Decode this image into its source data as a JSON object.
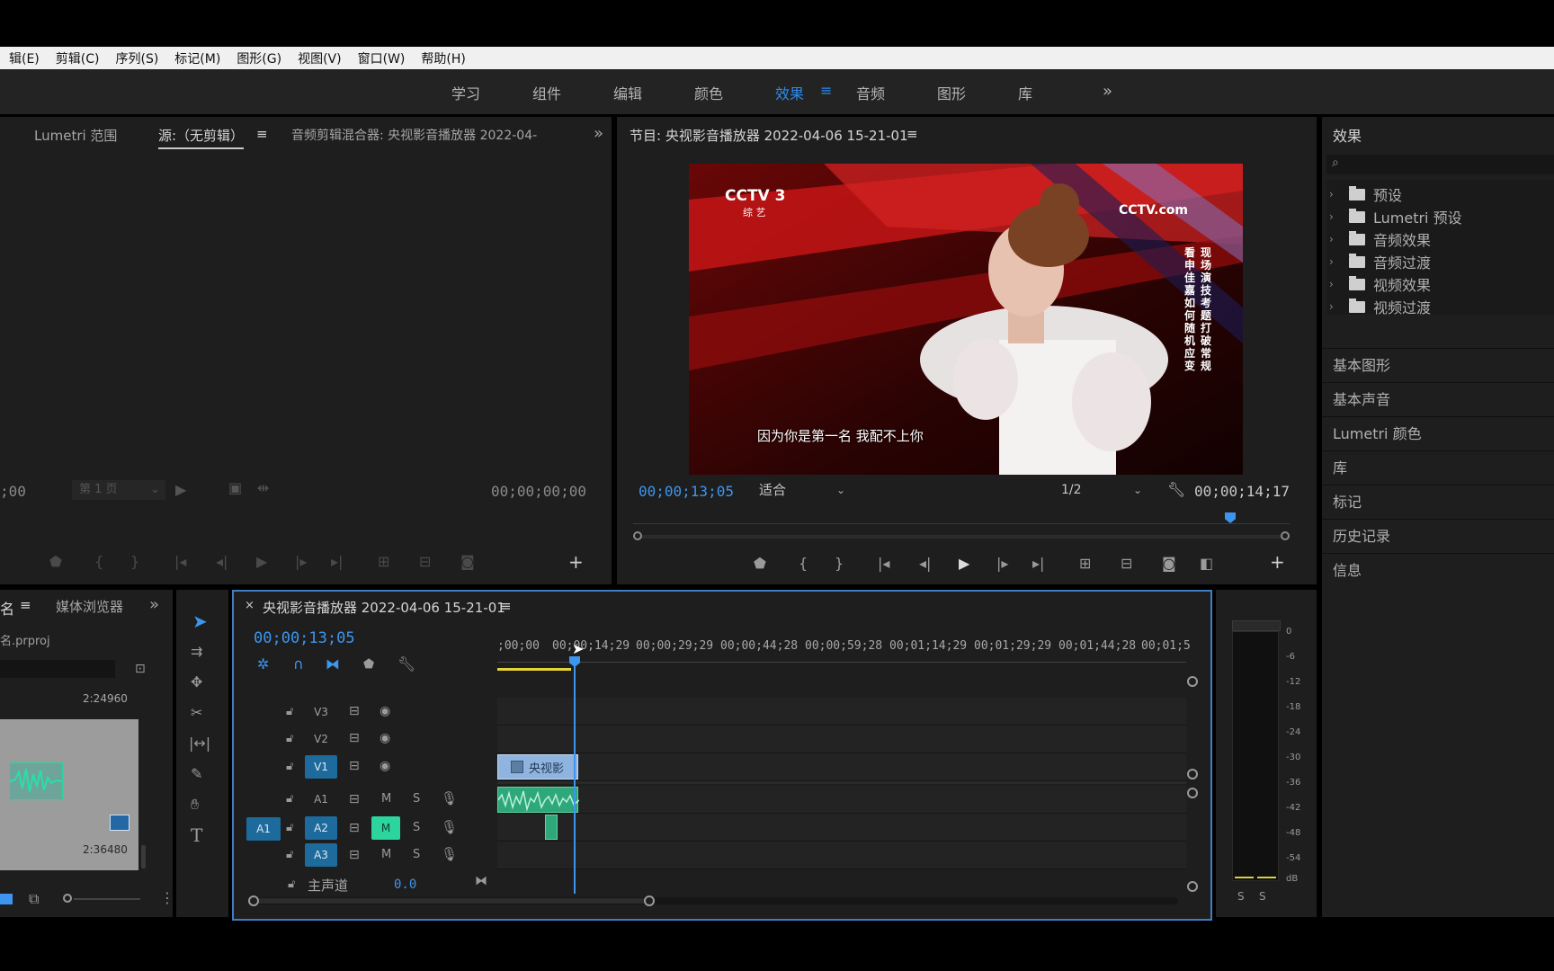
{
  "menu": [
    "辑(E)",
    "剪辑(C)",
    "序列(S)",
    "标记(M)",
    "图形(G)",
    "视图(V)",
    "窗口(W)",
    "帮助(H)"
  ],
  "workspaces": [
    "学习",
    "组件",
    "编辑",
    "颜色",
    "效果",
    "音频",
    "图形",
    "库"
  ],
  "active_workspace": "效果",
  "source_panel": {
    "tabs": [
      "Lumetri 范围",
      "源:（无剪辑）",
      "音频剪辑混合器: 央视影音播放器 2022-04-"
    ],
    "left_tc": ";00",
    "page": "第 1 页",
    "right_tc": "00;00;00;00"
  },
  "program": {
    "title": "节目: 央视影音播放器 2022-04-06 15-21-01",
    "timecode": "00;00;13;05",
    "fit": "适合",
    "resolution": "1/2",
    "duration": "00;00;14;17",
    "frame": {
      "channel_logo": "CCTV 3",
      "channel_sub": "综 艺",
      "watermark": "CCTV.com",
      "caption": "因为你是第一名 我配不上你",
      "side_text_1": "现场演技考题打破常规",
      "side_text_2": "看申佳嘉如何随机应变"
    }
  },
  "effects": {
    "title": "效果",
    "items": [
      "预设",
      "Lumetri 预设",
      "音频效果",
      "音频过渡",
      "视频效果",
      "视频过渡"
    ],
    "sections": [
      "基本图形",
      "基本声音",
      "Lumetri 颜色",
      "库",
      "标记",
      "历史记录",
      "信息"
    ]
  },
  "project": {
    "tab_name": "名",
    "tab_media": "媒体浏览器",
    "file": "名.prproj",
    "dur1": "2:24960",
    "dur2": "2:36480"
  },
  "timeline": {
    "title": "央视影音播放器 2022-04-06 15-21-01",
    "timecode": "00;00;13;05",
    "ruler": [
      ";00;00",
      "00;00;14;29",
      "00;00;29;29",
      "00;00;44;28",
      "00;00;59;28",
      "00;01;14;29",
      "00;01;29;29",
      "00;01;44;28",
      "00;01;5"
    ],
    "video_tracks": [
      "V3",
      "V2",
      "V1"
    ],
    "audio_tracks": [
      "A1",
      "A2",
      "A3"
    ],
    "source_patch": "A1",
    "clip_label": "央视影",
    "master": "主声道",
    "master_value": "0.0",
    "mute": "M",
    "solo": "S"
  },
  "meter": {
    "labels": [
      "0",
      "-6",
      "-12",
      "-18",
      "-24",
      "-30",
      "-36",
      "-42",
      "-48",
      "-54",
      "dB"
    ],
    "solo": [
      "S",
      "S"
    ]
  }
}
